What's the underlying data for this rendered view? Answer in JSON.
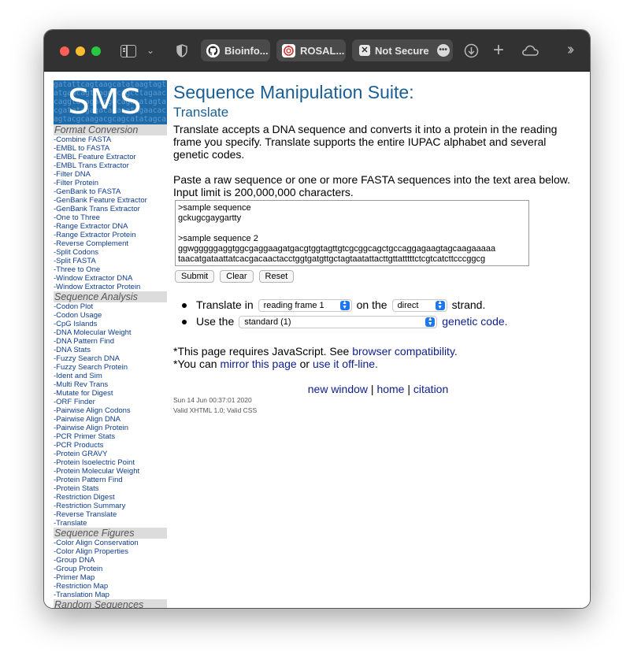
{
  "browser": {
    "tabs": [
      {
        "label": "Bioinfo...",
        "icon": "github-icon"
      },
      {
        "label": "ROSAL...",
        "icon": "rosalind-icon"
      },
      {
        "label": "Not Secure",
        "icon": "not-secure-icon"
      }
    ]
  },
  "logo": {
    "text": "SMS",
    "bg_text": "gatattcagtaagcatataagtagtatgaacagtcaggacagcctagaaccaggtacagaccgacagacatagtacgatatagagacagacatagaacacagtacgcaagacgcagcatatagcatataa"
  },
  "nav": {
    "sections": [
      {
        "title": "Format Conversion",
        "items": [
          "-Combine FASTA",
          "-EMBL to FASTA",
          "-EMBL Feature Extractor",
          "-EMBL Trans Extractor",
          "-Filter DNA",
          "-Filter Protein",
          "-GenBank to FASTA",
          "-GenBank Feature Extractor",
          "-GenBank Trans Extractor",
          "-One to Three",
          "-Range Extractor DNA",
          "-Range Extractor Protein",
          "-Reverse Complement",
          "-Split Codons",
          "-Split FASTA",
          "-Three to One",
          "-Window Extractor DNA",
          "-Window Extractor Protein"
        ]
      },
      {
        "title": "Sequence Analysis",
        "items": [
          "-Codon Plot",
          "-Codon Usage",
          "-CpG Islands",
          "-DNA Molecular Weight",
          "-DNA Pattern Find",
          "-DNA Stats",
          "-Fuzzy Search DNA",
          "-Fuzzy Search Protein",
          "-Ident and Sim",
          "-Multi Rev Trans",
          "-Mutate for Digest",
          "-ORF Finder",
          "-Pairwise Align Codons",
          "-Pairwise Align DNA",
          "-Pairwise Align Protein",
          "-PCR Primer Stats",
          "-PCR Products",
          "-Protein GRAVY",
          "-Protein Isoelectric Point",
          "-Protein Molecular Weight",
          "-Protein Pattern Find",
          "-Protein Stats",
          "-Restriction Digest",
          "-Restriction Summary",
          "-Reverse Translate",
          "-Translate"
        ]
      },
      {
        "title": "Sequence Figures",
        "items": [
          "-Color Align Conservation",
          "-Color Align Properties",
          "-Group DNA",
          "-Group Protein",
          "-Primer Map",
          "-Restriction Map",
          "-Translation Map"
        ]
      },
      {
        "title": "Random Sequences",
        "items": []
      }
    ]
  },
  "main": {
    "title": "Sequence Manipulation Suite:",
    "subtitle": "Translate",
    "intro": "Translate accepts a DNA sequence and converts it into a protein in the reading frame you specify. Translate supports the entire IUPAC alphabet and several genetic codes.",
    "paste_instructions_1": "Paste a raw sequence or one or more FASTA sequences into the text area below.",
    "paste_instructions_2": "Input limit is 200,000,000 characters.",
    "sequence_text": ">sample sequence\ngckugcgaygartty\n\n>sample sequence 2\nggwgggggaggtggcgaggaagatgacgtggtagttgtcgcggcagctgccaggagaagtagcaagaaaaa\ntaacatgataattatcacgacaactacctggtgatgttgctagtaatattacttgttatttttctcgtcatcttcccggcg",
    "buttons": {
      "submit": "Submit",
      "clear": "Clear",
      "reset": "Reset"
    },
    "option1": {
      "prefix": "Translate in",
      "frame_select": "reading frame 1",
      "middle": "on the",
      "strand_select": "direct",
      "suffix": "strand."
    },
    "option2": {
      "prefix": "Use the",
      "code_select": "standard (1)",
      "link": "genetic code."
    },
    "note1_text": "*This page requires JavaScript. See ",
    "note1_link": "browser compatibility.",
    "note2_text": "*You can ",
    "note2_link1": "mirror this page",
    "note2_mid": " or ",
    "note2_link2": "use it off-line.",
    "footer_links": {
      "new_window": "new window",
      "sep1": " | ",
      "home": "home",
      "sep2": " | ",
      "citation": "citation"
    },
    "timestamp": "Sun 14 Jun 00:37:01 2020",
    "validity": "Valid XHTML 1.0; Valid CSS"
  }
}
